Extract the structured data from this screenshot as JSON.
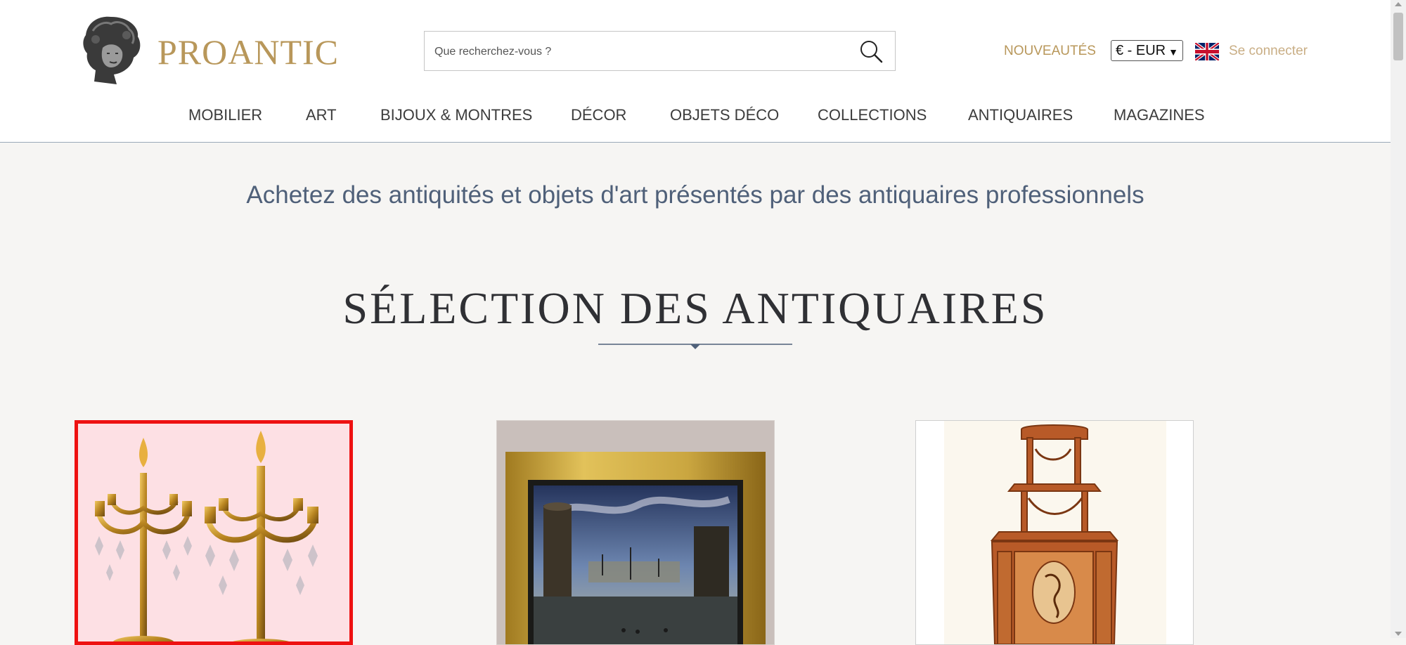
{
  "header": {
    "logo_text": "PROANTIC",
    "search_placeholder": "Que recherchez-vous ?",
    "search_value": "",
    "nouveautes_label": "NOUVEAUTÉS",
    "currency_selected": "€ - EUR",
    "login_label": "Se connecter",
    "language_flag": "uk-flag-icon"
  },
  "nav": {
    "items": [
      {
        "label": "MOBILIER"
      },
      {
        "label": "ART"
      },
      {
        "label": "BIJOUX & MONTRES"
      },
      {
        "label": "DÉCOR"
      },
      {
        "label": "OBJETS DÉCO"
      },
      {
        "label": "COLLECTIONS"
      },
      {
        "label": "ANTIQUAIRES"
      },
      {
        "label": "MAGAZINES"
      }
    ]
  },
  "main": {
    "tagline": "Achetez des antiquités et objets d'art présentés par des antiquaires professionnels",
    "section_title": "SÉLECTION DES ANTIQUAIRES",
    "cards": [
      {
        "subject": "gilt-bronze-candelabra-pair",
        "selected": true
      },
      {
        "subject": "gilt-framed-harbor-painting",
        "selected": false
      },
      {
        "subject": "marquetry-corner-etagere",
        "selected": false
      }
    ]
  },
  "colors": {
    "brand_gold": "#b8975a",
    "tagline_blue": "#4f6079",
    "selection_red": "#ee1111",
    "page_background": "#f6f5f3"
  }
}
